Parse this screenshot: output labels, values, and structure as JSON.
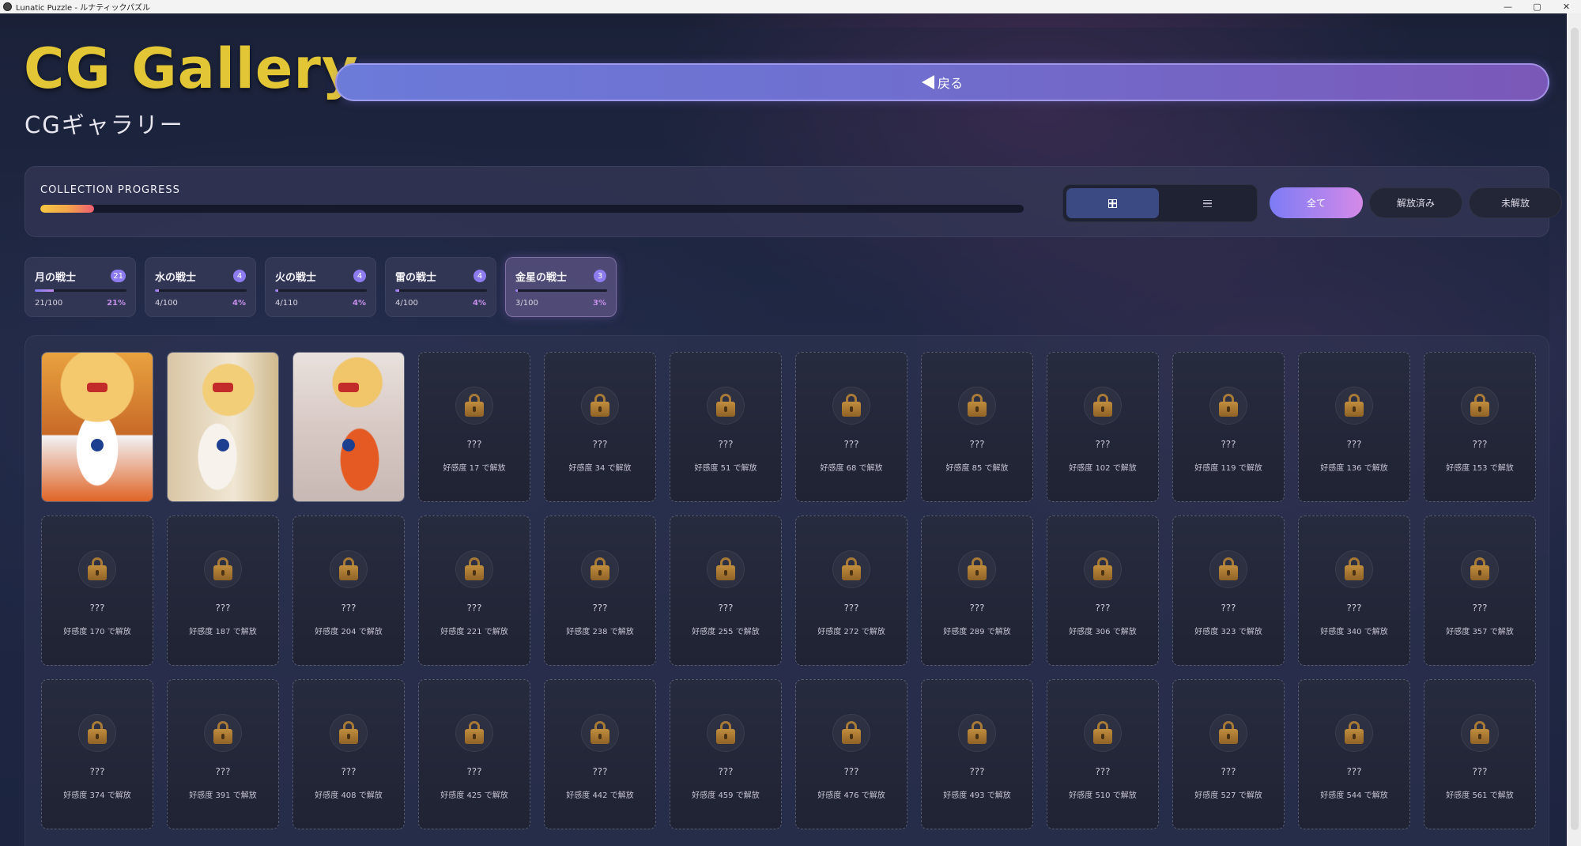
{
  "window": {
    "title": "Lunatic Puzzle - ルナティックパズル",
    "controls": [
      "—",
      "▢",
      "✕"
    ]
  },
  "header": {
    "title": "CG Gallery",
    "subtitle": "CGギャラリー",
    "back_label": "戻る"
  },
  "progress": {
    "label": "COLLECTION PROGRESS",
    "fraction": 0.055
  },
  "view_toggle": {
    "grid_icon": "grid-icon",
    "list_icon": "list-icon",
    "active": "grid"
  },
  "filters": [
    {
      "label": "全て",
      "active": true
    },
    {
      "label": "解放済み",
      "active": false
    },
    {
      "label": "未解放",
      "active": false
    }
  ],
  "characters": [
    {
      "name": "月の戦士",
      "badge": "21",
      "count": "21/100",
      "percent": "21%",
      "fraction": 0.21,
      "selected": false
    },
    {
      "name": "水の戦士",
      "badge": "4",
      "count": "4/100",
      "percent": "4%",
      "fraction": 0.04,
      "selected": false
    },
    {
      "name": "火の戦士",
      "badge": "4",
      "count": "4/110",
      "percent": "4%",
      "fraction": 0.036,
      "selected": false
    },
    {
      "name": "雷の戦士",
      "badge": "4",
      "count": "4/100",
      "percent": "4%",
      "fraction": 0.04,
      "selected": false
    },
    {
      "name": "金星の戦士",
      "badge": "3",
      "count": "3/100",
      "percent": "3%",
      "fraction": 0.03,
      "selected": true
    }
  ],
  "gallery": {
    "unlocked_count": 3,
    "locked_text": "???",
    "cards": [
      {
        "locked": false,
        "art": "art-1"
      },
      {
        "locked": false,
        "art": "art-2"
      },
      {
        "locked": false,
        "art": "art-3"
      },
      {
        "locked": true,
        "condition": "好感度 17 で解放"
      },
      {
        "locked": true,
        "condition": "好感度 34 で解放"
      },
      {
        "locked": true,
        "condition": "好感度 51 で解放"
      },
      {
        "locked": true,
        "condition": "好感度 68 で解放"
      },
      {
        "locked": true,
        "condition": "好感度 85 で解放"
      },
      {
        "locked": true,
        "condition": "好感度 102 で解放"
      },
      {
        "locked": true,
        "condition": "好感度 119 で解放"
      },
      {
        "locked": true,
        "condition": "好感度 136 で解放"
      },
      {
        "locked": true,
        "condition": "好感度 153 で解放"
      },
      {
        "locked": true,
        "condition": "好感度 170 で解放"
      },
      {
        "locked": true,
        "condition": "好感度 187 で解放"
      },
      {
        "locked": true,
        "condition": "好感度 204 で解放"
      },
      {
        "locked": true,
        "condition": "好感度 221 で解放"
      },
      {
        "locked": true,
        "condition": "好感度 238 で解放"
      },
      {
        "locked": true,
        "condition": "好感度 255 で解放"
      },
      {
        "locked": true,
        "condition": "好感度 272 で解放"
      },
      {
        "locked": true,
        "condition": "好感度 289 で解放"
      },
      {
        "locked": true,
        "condition": "好感度 306 で解放"
      },
      {
        "locked": true,
        "condition": "好感度 323 で解放"
      },
      {
        "locked": true,
        "condition": "好感度 340 で解放"
      },
      {
        "locked": true,
        "condition": "好感度 357 で解放"
      },
      {
        "locked": true,
        "condition": "好感度 374 で解放"
      },
      {
        "locked": true,
        "condition": "好感度 391 で解放"
      },
      {
        "locked": true,
        "condition": "好感度 408 で解放"
      },
      {
        "locked": true,
        "condition": "好感度 425 で解放"
      },
      {
        "locked": true,
        "condition": "好感度 442 で解放"
      },
      {
        "locked": true,
        "condition": "好感度 459 で解放"
      },
      {
        "locked": true,
        "condition": "好感度 476 で解放"
      },
      {
        "locked": true,
        "condition": "好感度 493 で解放"
      },
      {
        "locked": true,
        "condition": "好感度 510 で解放"
      },
      {
        "locked": true,
        "condition": "好感度 527 で解放"
      },
      {
        "locked": true,
        "condition": "好感度 544 で解放"
      },
      {
        "locked": true,
        "condition": "好感度 561 で解放"
      }
    ]
  },
  "colors": {
    "title_gold": "#e2c635",
    "accent_purple": "#8d7cf0",
    "progress_start": "#f6c744",
    "progress_end": "#ef5f72"
  }
}
